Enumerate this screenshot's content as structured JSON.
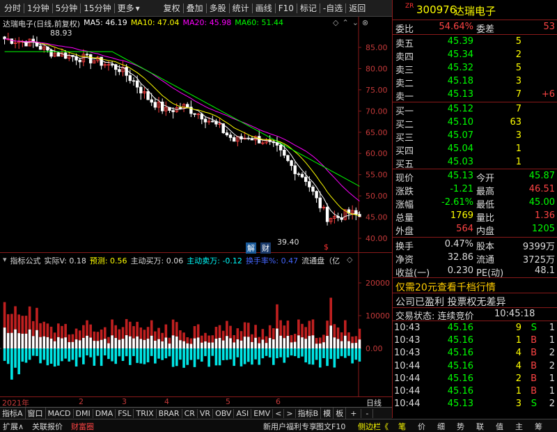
{
  "toolbar": {
    "left": [
      "分时",
      "1分钟",
      "5分钟",
      "15分钟",
      "更多"
    ],
    "right": [
      "复权",
      "叠加",
      "多股",
      "统计",
      "画线",
      "F10",
      "标记",
      "-自选",
      "返回"
    ]
  },
  "chart": {
    "title": "达瑞电子(日线,前复权)",
    "ma": [
      {
        "label": "MA5: 46.19",
        "color": "#ffffff"
      },
      {
        "label": "MA10: 47.04",
        "color": "#ffff00"
      },
      {
        "label": "MA20: 45.98",
        "color": "#ff00ff"
      },
      {
        "label": "MA60: 51.44",
        "color": "#00ff00"
      }
    ],
    "yticks": [
      "85.00",
      "80.00",
      "75.00",
      "70.00",
      "65.00",
      "60.00",
      "55.00",
      "50.00",
      "45.00",
      "40.00"
    ],
    "high_annot": "88.93",
    "low_annot": "39.40",
    "markers": {
      "jie": "解",
      "cai": "财",
      "dollar": "$"
    }
  },
  "indicator": {
    "legend": [
      {
        "label": "指标公式",
        "color": "#dddddd"
      },
      {
        "label": "实际V: 0.18",
        "color": "#dddddd"
      },
      {
        "label": "预测: 0.56",
        "color": "#ffff00"
      },
      {
        "label": "主动买万: 0.06",
        "color": "#dddddd"
      },
      {
        "label": "主动卖万: -0.12",
        "color": "#00ffff"
      },
      {
        "label": "换手率%: 0.47",
        "color": "#4466ff"
      },
      {
        "label": "流通盘（亿",
        "color": "#dddddd"
      }
    ],
    "yticks": [
      "20000",
      "10000",
      "0.00"
    ]
  },
  "xaxis": {
    "labels": [
      "2021年",
      "2",
      "3",
      "4",
      "5",
      "6"
    ],
    "right": "日线"
  },
  "bottom_tabs": [
    "指标A",
    "窗口",
    "MACD",
    "DMI",
    "DMA",
    "FSL",
    "TRIX",
    "BRAR",
    "CR",
    "VR",
    "OBV",
    "ASI",
    "EMV",
    "<",
    ">",
    "指标B",
    "模",
    "板",
    "+",
    "-"
  ],
  "statusbar": {
    "left": [
      "扩展∧",
      "关联报价",
      "财富圈"
    ],
    "mid": [
      "新用户福利专享",
      "图文F10",
      "侧边栏《"
    ],
    "right": [
      "笔",
      "价",
      "细",
      "势",
      "联",
      "值",
      "主",
      "筹"
    ]
  },
  "stock": {
    "badge": "ZR",
    "code": "300976",
    "name": "达瑞电子"
  },
  "weibi": {
    "label1": "委比",
    "value1": "54.64%",
    "label2": "委差",
    "value2": "53"
  },
  "asks": [
    {
      "label": "卖五",
      "price": "45.39",
      "vol": "5",
      "chg": ""
    },
    {
      "label": "卖四",
      "price": "45.34",
      "vol": "2",
      "chg": ""
    },
    {
      "label": "卖三",
      "price": "45.32",
      "vol": "5",
      "chg": ""
    },
    {
      "label": "卖二",
      "price": "45.18",
      "vol": "3",
      "chg": ""
    },
    {
      "label": "卖一",
      "price": "45.13",
      "vol": "7",
      "chg": "+6"
    }
  ],
  "bids": [
    {
      "label": "买一",
      "price": "45.12",
      "vol": "7"
    },
    {
      "label": "买二",
      "price": "45.10",
      "vol": "63"
    },
    {
      "label": "买三",
      "price": "45.07",
      "vol": "3"
    },
    {
      "label": "买四",
      "price": "45.04",
      "vol": "1"
    },
    {
      "label": "买五",
      "price": "45.03",
      "vol": "1"
    }
  ],
  "quote": [
    {
      "l1": "现价",
      "v1": "45.13",
      "c1": "#00ff00",
      "l2": "今开",
      "v2": "45.87",
      "c2": "#00ff00"
    },
    {
      "l1": "涨跌",
      "v1": "-1.21",
      "c1": "#00ff00",
      "l2": "最高",
      "v2": "46.51",
      "c2": "#ff4444"
    },
    {
      "l1": "涨幅",
      "v1": "-2.61%",
      "c1": "#00ff00",
      "l2": "最低",
      "v2": "45.00",
      "c2": "#00ff00"
    },
    {
      "l1": "总量",
      "v1": "1769",
      "c1": "#ffff00",
      "l2": "量比",
      "v2": "1.36",
      "c2": "#ff4444"
    },
    {
      "l1": "外盘",
      "v1": "564",
      "c1": "#ff4444",
      "l2": "内盘",
      "v2": "1205",
      "c2": "#00ff00"
    }
  ],
  "finance": [
    {
      "l1": "换手",
      "v1": "0.47%",
      "l2": "股本",
      "v2": "9399万"
    },
    {
      "l1": "净资",
      "v1": "32.86",
      "l2": "流通",
      "v2": "3725万"
    },
    {
      "l1": "收益(一)",
      "v1": "0.230",
      "l2": "PE(动)",
      "v2": "48.1"
    }
  ],
  "promo": "仅需20元查看千档行情",
  "notice": "公司已盈利 投票权无差异",
  "trade_state": {
    "label": "交易状态: 连续竞价",
    "time": "10:45:18"
  },
  "ticks": [
    {
      "time": "10:43",
      "price": "45.16",
      "vol": "9",
      "side": "S",
      "n": "1"
    },
    {
      "time": "10:43",
      "price": "45.16",
      "vol": "1",
      "side": "B",
      "n": "1"
    },
    {
      "time": "10:43",
      "price": "45.16",
      "vol": "4",
      "side": "B",
      "n": "2"
    },
    {
      "time": "10:44",
      "price": "45.16",
      "vol": "4",
      "side": "B",
      "n": "2"
    },
    {
      "time": "10:44",
      "price": "45.16",
      "vol": "2",
      "side": "B",
      "n": "1"
    },
    {
      "time": "10:44",
      "price": "45.16",
      "vol": "1",
      "side": "B",
      "n": "1"
    },
    {
      "time": "10:44",
      "price": "45.13",
      "vol": "3",
      "side": "S",
      "n": "2"
    }
  ]
}
